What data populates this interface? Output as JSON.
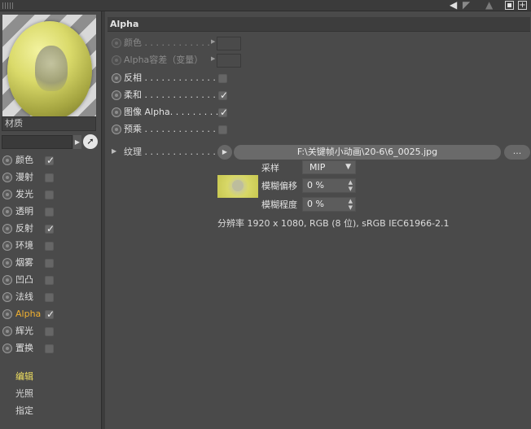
{
  "toolbar": {
    "lock_icon": "lock-icon",
    "add_icon": "+"
  },
  "left": {
    "material_label": "材质",
    "channels": [
      {
        "label": "颜色",
        "checked": true,
        "active": false
      },
      {
        "label": "漫射",
        "checked": false,
        "active": false
      },
      {
        "label": "发光",
        "checked": false,
        "active": false
      },
      {
        "label": "透明",
        "checked": false,
        "active": false
      },
      {
        "label": "反射",
        "checked": true,
        "active": false
      },
      {
        "label": "环境",
        "checked": false,
        "active": false
      },
      {
        "label": "烟雾",
        "checked": false,
        "active": false
      },
      {
        "label": "凹凸",
        "checked": false,
        "active": false
      },
      {
        "label": "法线",
        "checked": false,
        "active": false
      },
      {
        "label": "Alpha",
        "checked": true,
        "active": true
      },
      {
        "label": "辉光",
        "checked": false,
        "active": false
      },
      {
        "label": "置换",
        "checked": false,
        "active": false
      }
    ],
    "sub_items": [
      {
        "label": "编辑",
        "active": true
      },
      {
        "label": "光照",
        "active": false
      },
      {
        "label": "指定",
        "active": false
      }
    ]
  },
  "right": {
    "section_title": "Alpha",
    "color_label": "颜色 . . . . . . . . . . . .",
    "delta_label": "Alpha容差（变量）",
    "invert_label": "反相 . . . . . . . . . . . . . .",
    "soft_label": "柔和 . . . . . . . . . . . . . .",
    "image_alpha_label": "图像 Alpha. . . . . . . . .",
    "premultiply_label": "预乘 . . . . . . . . . . . . . .",
    "texture_label": "纹理 . . . . . . . . . . . . . .",
    "texture_path": "F:\\关键帧小动画\\20-6\\6_0025.jpg",
    "browse_label": "...",
    "sampling_label": "采样",
    "sampling_value": "MIP",
    "blur_offset_label": "模糊偏移",
    "blur_offset_value": "0 %",
    "blur_scale_label": "模糊程度",
    "blur_scale_value": "0 %",
    "resolution_info": "分辨率 1920 x 1080, RGB (8 位), sRGB IEC61966-2.1"
  }
}
